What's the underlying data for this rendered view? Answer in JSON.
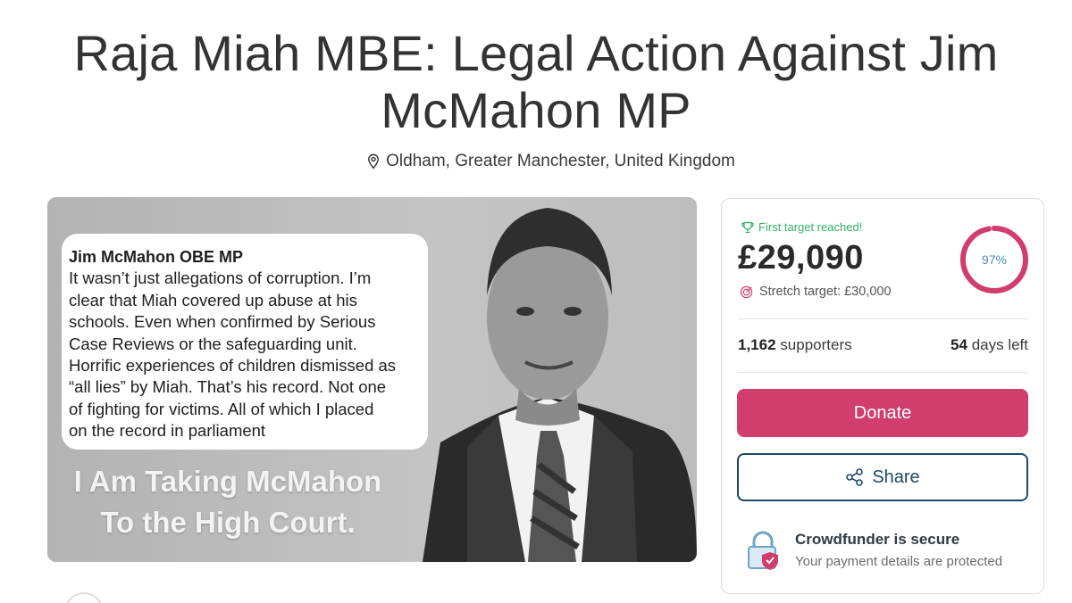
{
  "campaign": {
    "title": "Raja Miah MBE: Legal Action Against Jim McMahon MP",
    "location": "Oldham, Greater Manchester, United Kingdom"
  },
  "hero_image": {
    "quote_author": "Jim McMahon OBE MP",
    "quote_lines": [
      "It wasn’t just allegations of corruption. I’m",
      "clear that Miah covered up abuse at his",
      "schools. Even when confirmed by Serious",
      "Case Reviews or the safeguarding unit.",
      "Horrific experiences of children dismissed as",
      "“all lies” by Miah. That’s his record. Not one",
      "of fighting for victims. All of which I placed",
      "on the record in parliament"
    ],
    "caption_line1": "I Am Taking McMahon",
    "caption_line2": "To the High Court."
  },
  "funding": {
    "target_status": "First target reached!",
    "amount": "£29,090",
    "stretch_label": "Stretch target: £30,000",
    "progress_percent": 97,
    "progress_label": "97%",
    "supporters_count": "1,162",
    "supporters_label": "supporters",
    "days_count": "54",
    "days_label": "days left"
  },
  "actions": {
    "donate_label": "Donate",
    "share_label": "Share"
  },
  "security": {
    "title": "Crowdfunder is secure",
    "subtitle": "Your payment details are protected"
  },
  "colors": {
    "accent": "#d13e6b",
    "share_border": "#1c4966",
    "success": "#35b06a",
    "progress_text": "#4b8fbf"
  }
}
